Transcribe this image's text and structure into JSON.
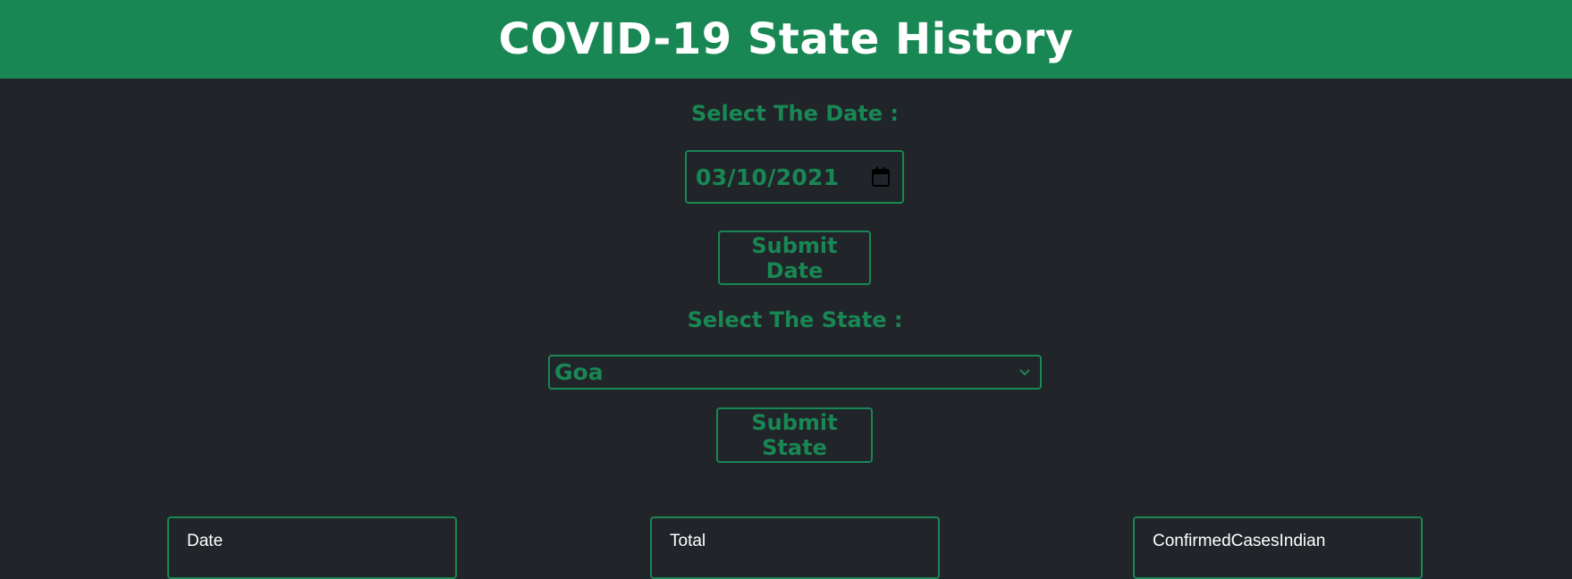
{
  "header": {
    "title": "COVID-19 State History"
  },
  "date_section": {
    "label": "Select The Date :",
    "date_value": "03/10/2021",
    "submit_label": "Submit Date"
  },
  "state_section": {
    "label": "Select The State :",
    "selected_state": "Goa",
    "submit_label": "Submit State"
  },
  "cards": [
    {
      "label": "Date"
    },
    {
      "label": "Total"
    },
    {
      "label": "ConfirmedCasesIndian"
    }
  ],
  "colors": {
    "accent": "#198754",
    "background": "#212529",
    "header_text": "#ffffff"
  },
  "icons": {
    "date_picker": "calendar-icon",
    "select": "chevron-down-icon"
  }
}
